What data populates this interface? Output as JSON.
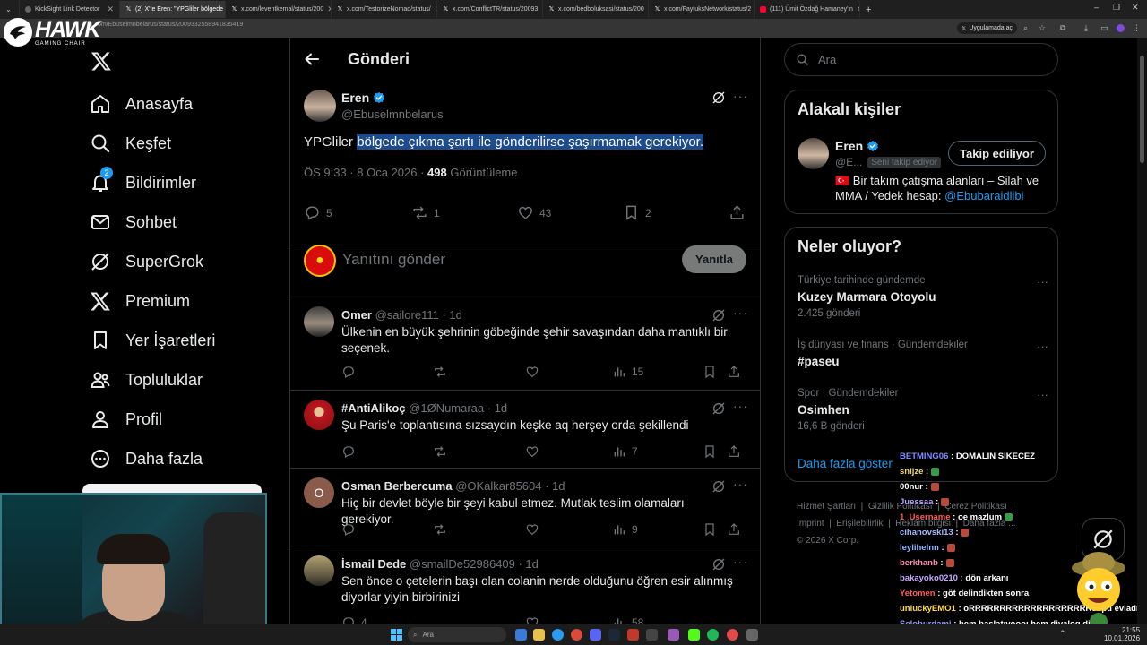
{
  "browser": {
    "tabs": [
      {
        "label": "KickSight Link Detector",
        "active": false
      },
      {
        "label": "(2) X'te Eren: \"YPGliler bölgede",
        "active": true
      },
      {
        "label": "x.com/leventkemal/status/200",
        "active": false
      },
      {
        "label": "x.com/TestorizeNomad/status/",
        "active": false
      },
      {
        "label": "x.com/ConflictTR/status/20093",
        "active": false
      },
      {
        "label": "x.com/bedboluksasi/status/200",
        "active": false
      },
      {
        "label": "x.com/FaytuksNetwork/status/2",
        "active": false
      },
      {
        "label": "(111) Ümit Özdağ Hamaney'in",
        "active": false
      }
    ],
    "url": "x.com/Ebuselmnbelarus/status/2009332558941835419",
    "app_mode": "Uygulamada aç"
  },
  "stream": {
    "logo_brand": "HAWK",
    "logo_sub": "GAMING CHAIR",
    "chat": [
      {
        "user": "BETMING06",
        "msg": ": DOMALIN SIKECEZ",
        "color": "#7f8cff",
        "emote": ""
      },
      {
        "user": "snijze",
        "msg": ":",
        "color": "#f0d26a",
        "emote": "green"
      },
      {
        "user": "00nur",
        "msg": ":",
        "color": "#ffffff",
        "emote": "red"
      },
      {
        "user": "Juessaa",
        "msg": ":",
        "color": "#b7a2ff",
        "emote": "red"
      },
      {
        "user": "1_Username",
        "msg": ": oe mazlum",
        "color": "#ff5a5a",
        "emote": "green"
      },
      {
        "user": "cihanovski13",
        "msg": ":",
        "color": "#a6b8ff",
        "emote": "red"
      },
      {
        "user": "leylihelnn",
        "msg": ":",
        "color": "#8fb8ff",
        "emote": "red"
      },
      {
        "user": "berkhanb",
        "msg": ":",
        "color": "#ff8fb0",
        "emote": "red"
      },
      {
        "user": "bakayoko0210",
        "msg": ": dön arkanı",
        "color": "#c6a7ff",
        "emote": ""
      },
      {
        "user": "Yetomen",
        "msg": ": göt delindikten sonra",
        "color": "#ff5a5a",
        "emote": ""
      },
      {
        "user": "unluckyEMO1",
        "msg": ": oRRRRRRRRRRRRRRRRRRRRospu evladı",
        "color": "#ffd84a",
        "emote": ""
      },
      {
        "user": "Seloburdami",
        "msg": ": hem başlatıyoooı hem diyalog diyoo",
        "color": "#8fa0ff",
        "emote": ""
      }
    ]
  },
  "nav": {
    "items": [
      {
        "label": "Anasayfa",
        "icon": "home-icon"
      },
      {
        "label": "Keşfet",
        "icon": "search-icon"
      },
      {
        "label": "Bildirimler",
        "icon": "bell-icon",
        "badge": "2"
      },
      {
        "label": "Sohbet",
        "icon": "mail-icon"
      },
      {
        "label": "SuperGrok",
        "icon": "grok-icon"
      },
      {
        "label": "Premium",
        "icon": "x-icon"
      },
      {
        "label": "Yer İşaretleri",
        "icon": "bookmark-icon"
      },
      {
        "label": "Topluluklar",
        "icon": "people-icon"
      },
      {
        "label": "Profil",
        "icon": "user-icon"
      },
      {
        "label": "Daha fazla",
        "icon": "more-circle-icon"
      }
    ]
  },
  "header": {
    "title": "Gönderi"
  },
  "main_tweet": {
    "name": "Eren",
    "handle": "@Ebuselmnbelarus",
    "text_plain": "YPGliler ",
    "text_highlight": "bölgede çıkma şartı ile gönderilirse şaşırmamak gerekiyor.",
    "time": "ÖS 9:33 · 8 Oca 2026 · ",
    "views": "498",
    "views_label": " Görüntüleme",
    "replies": "5",
    "retweets": "1",
    "likes": "43",
    "bookmarks": "2"
  },
  "composer": {
    "placeholder": "Yanıtını gönder",
    "button": "Yanıtla"
  },
  "replies": [
    {
      "name": "Omer",
      "handle": "@sailore111 · 1d",
      "text": "Ülkenin en büyük şehrinin göbeğinde şehir savaşından daha mantıklı bir seçenek.",
      "views": "15",
      "avatar_color": "#6b6b6b"
    },
    {
      "name": "#AntiAlikoç",
      "handle": "@1ØNumaraa · 1d",
      "text": "Şu Paris'e toplantısına sızsaydın keşke aq herşey orda şekillendi",
      "views": "7",
      "avatar_color": "#b8161d"
    },
    {
      "name": "Osman Berbercuma",
      "handle": "@OKalkar85604 · 1d",
      "text": "Hiç bir devlet böyle bir şeyi kabul etmez. Mutlak teslim olamaları gerekiyor.",
      "views": "9",
      "avatar_color": "#8a5a4a",
      "avatar_letter": "O"
    },
    {
      "name": "İsmail Dede",
      "handle": "@smailDe52986409 · 1d",
      "text": "Sen önce o çetelerin başı olan colanin nerde olduğunu öğren esir alınmış diyorlar yiyin birbirinizi",
      "views": "58",
      "replies": "4",
      "avatar_color": "#7a6a50"
    }
  ],
  "search": {
    "placeholder": "Ara"
  },
  "related": {
    "title": "Alakalı kişiler",
    "name": "Eren",
    "handle": "@E...",
    "follows_you": "Seni takip ediyor",
    "button": "Takip ediliyor",
    "bio_text": "🇹🇷 Bir takım çatışma alanları – Silah ve MMA / Yedek hesap: ",
    "bio_link": "@Ebubaraidlibi"
  },
  "trends": {
    "title": "Neler oluyor?",
    "items": [
      {
        "context": "Türkiye tarihinde gündemde",
        "name": "Kuzey Marmara Otoyolu",
        "count": "2.425 gönderi"
      },
      {
        "context": "İş dünyası ve finans · Gündemdekiler",
        "name": "#paseu",
        "count": ""
      },
      {
        "context": "Spor · Gündemdekiler",
        "name": "Osimhen",
        "count": "16,6 B gönderi"
      }
    ],
    "show_more": "Daha fazla göster"
  },
  "footer": {
    "line1": [
      "Hizmet Şartları",
      "Gizlilik Politikası",
      "Çerez Politikası"
    ],
    "line2": [
      "Imprint",
      "Erişilebilirlik",
      "Reklam bilgisi",
      "Daha fazla ..."
    ],
    "copyright": "© 2026 X Corp."
  },
  "taskbar": {
    "search": "Ara",
    "time": "21:55",
    "date": "10.01.2026"
  }
}
